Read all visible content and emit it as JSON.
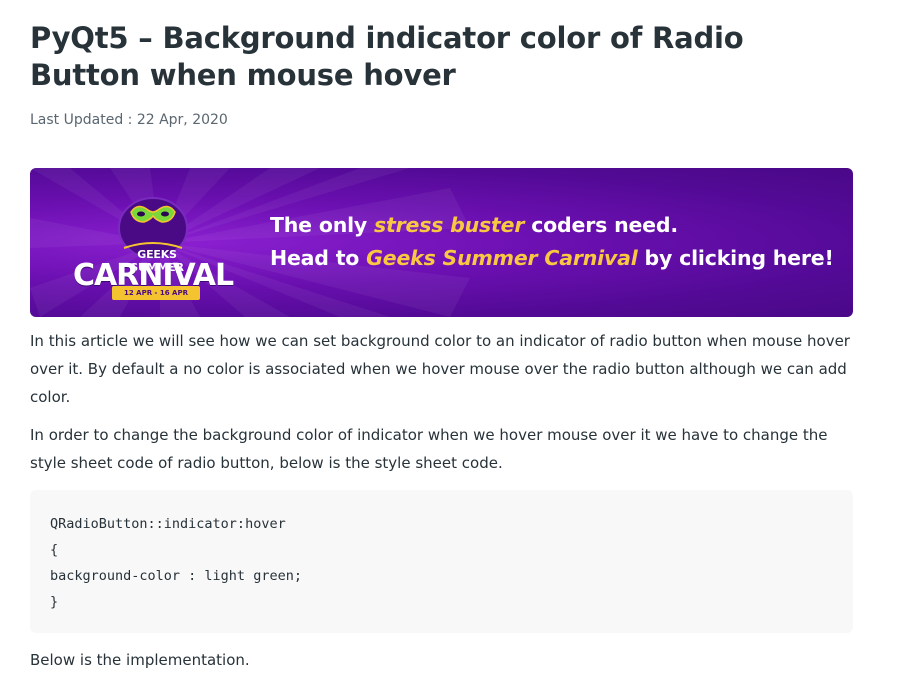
{
  "article": {
    "title": "PyQt5 – Background indicator color of Radio Button when mouse hover",
    "last_updated_label": "Last Updated : 22 Apr, 2020",
    "banner": {
      "logo_top": "GEEKS SUMMER",
      "logo_main": "CARNIVAL",
      "logo_dates": "12 APR - 16 APR",
      "line1_pre": "The only ",
      "line1_highlight": "stress buster",
      "line1_post": " coders need.",
      "line2_pre": "Head to ",
      "line2_highlight": "Geeks Summer Carnival",
      "line2_post": " by clicking here!",
      "colors": {
        "background": "#6a0fb0",
        "highlight": "#f9c741",
        "text": "#ffffff"
      }
    },
    "paragraph1": "In this article we will see how we can set background color to an indicator of radio button when mouse hover over it. By default a no color is associated when we hover mouse over the radio button although we can add color.",
    "paragraph2": "In order to change the background color of indicator when we hover mouse over it we have to change the style sheet code of radio button, below is the style sheet code.",
    "code_lines": [
      "QRadioButton::indicator:hover",
      "{",
      "background-color : light green;",
      "}"
    ],
    "paragraph3": "Below is the implementation."
  }
}
